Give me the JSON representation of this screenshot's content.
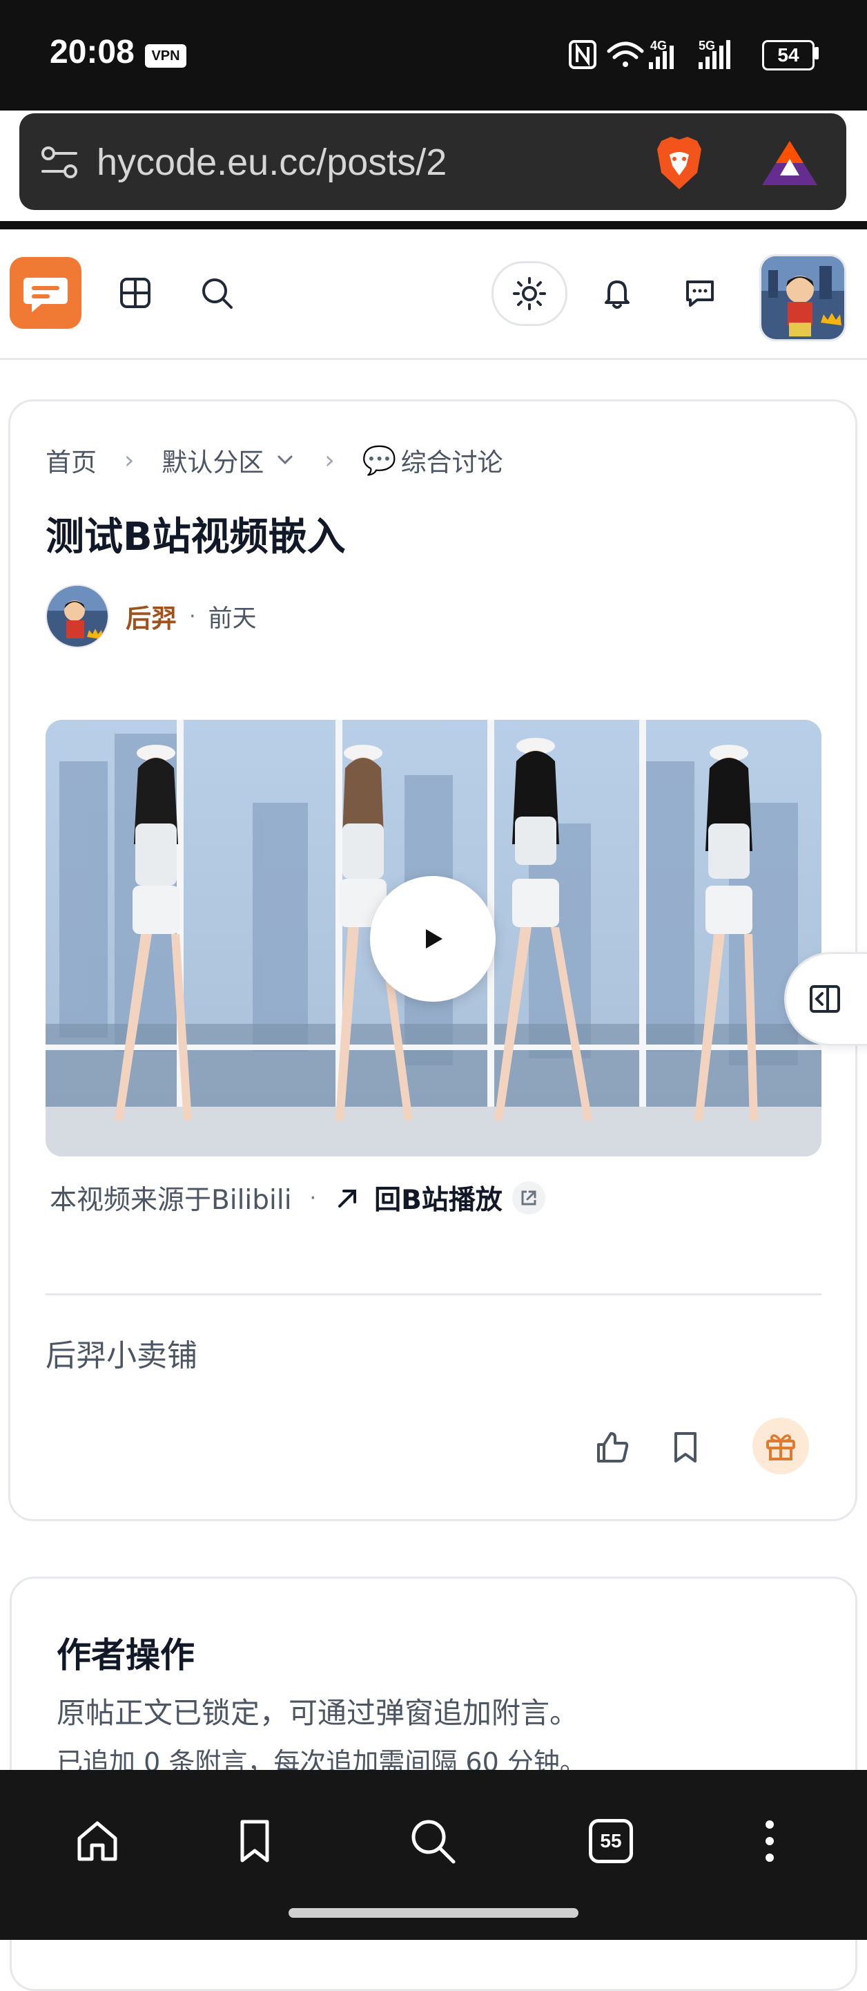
{
  "status_bar": {
    "time": "20:08",
    "vpn": "VPN",
    "network_4g": "4G",
    "network_5g": "5G",
    "battery": "54"
  },
  "browser": {
    "url": "hycode.eu.cc/posts/2",
    "tab_count": "55"
  },
  "breadcrumb": {
    "home": "首页",
    "category": "默认分区",
    "board_emoji": "💬",
    "board": "综合讨论"
  },
  "post": {
    "title": "测试B站视频嵌入",
    "author": "后羿",
    "time": "前天",
    "video_source": "本视频来源于Bilibili",
    "back_to_bilibili": "回B站播放",
    "body_text": "后羿小卖铺"
  },
  "author_ops": {
    "title": "作者操作",
    "line1": "原帖正文已锁定，可通过弹窗追加附言。",
    "line2": "已追加 0 条附言，每次追加需间隔 60 分钟。"
  },
  "colors": {
    "brand_orange": "#f07a34",
    "author_name": "#a0521d",
    "gift_bg": "#fde9d6"
  }
}
